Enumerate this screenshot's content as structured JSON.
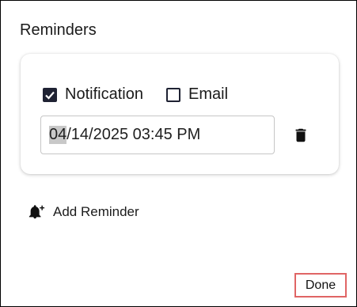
{
  "dialog": {
    "title": "Reminders"
  },
  "reminder": {
    "notification": {
      "label": "Notification",
      "checked": true
    },
    "email": {
      "label": "Email",
      "checked": false
    },
    "datetime": {
      "selected_segment": "04",
      "rest": "/14/2025 03:45 PM"
    },
    "delete_icon": "trash-icon"
  },
  "actions": {
    "add_reminder_label": "Add Reminder",
    "add_reminder_icon": "bell-plus-icon",
    "done_label": "Done"
  },
  "colors": {
    "checkbox": "#1f2233",
    "done_highlight": "#e06565"
  }
}
